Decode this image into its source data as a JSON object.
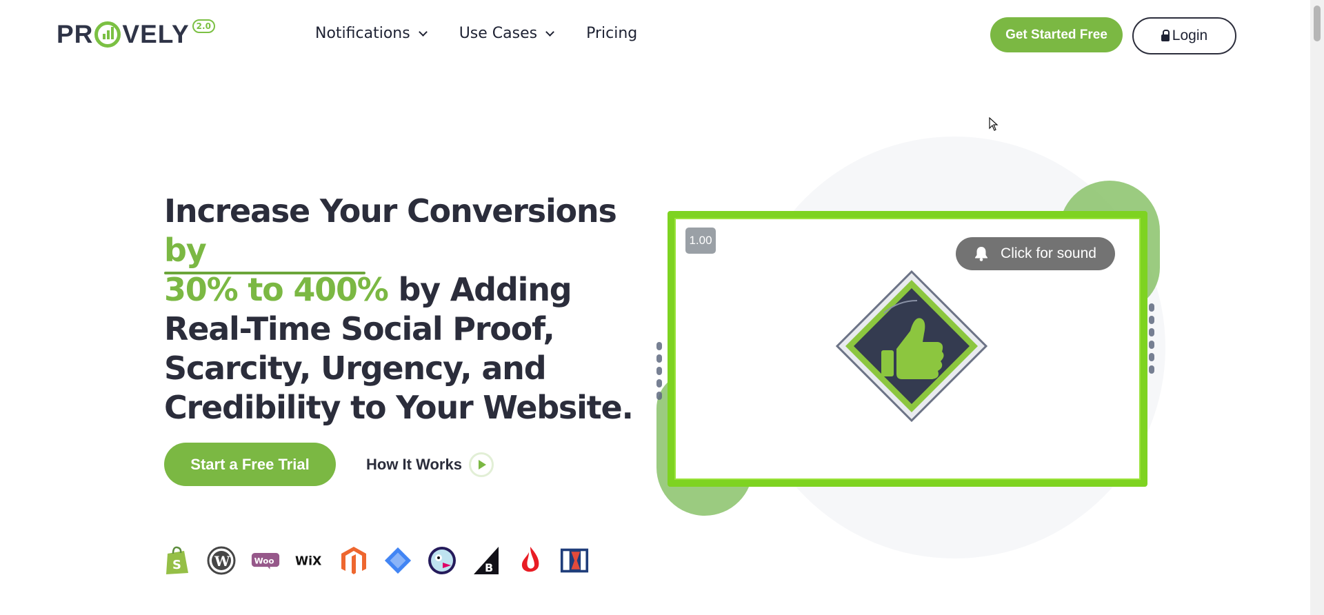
{
  "brand": {
    "name_part1": "PR",
    "name_part2": "VELY",
    "version": "2.0",
    "accent": "#7bb843"
  },
  "nav": {
    "items": [
      {
        "label": "Notifications",
        "has_dropdown": true
      },
      {
        "label": "Use Cases",
        "has_dropdown": true
      },
      {
        "label": "Pricing",
        "has_dropdown": false
      }
    ],
    "cta_label": "Get Started Free",
    "login_label": "Login"
  },
  "hero": {
    "title_part1": "Increase Your Conversions ",
    "title_highlight_a": "by",
    "title_highlight_b": "30% to 400%",
    "title_part2": " by Adding Real-Time Social Proof, Scarcity, Urgency, and Credibility to Your Website.",
    "primary_cta": "Start a Free Trial",
    "secondary_cta": "How It Works"
  },
  "platforms": [
    "shopify-icon",
    "wordpress-icon",
    "woocommerce-icon",
    "wix-icon",
    "magento-icon",
    "google-tag-manager-icon",
    "prestashop-icon",
    "bigcommerce-icon",
    "lightspeed-icon",
    "clickfunnels-icon"
  ],
  "video": {
    "speed": "1.00",
    "sound_label": "Click for sound"
  }
}
